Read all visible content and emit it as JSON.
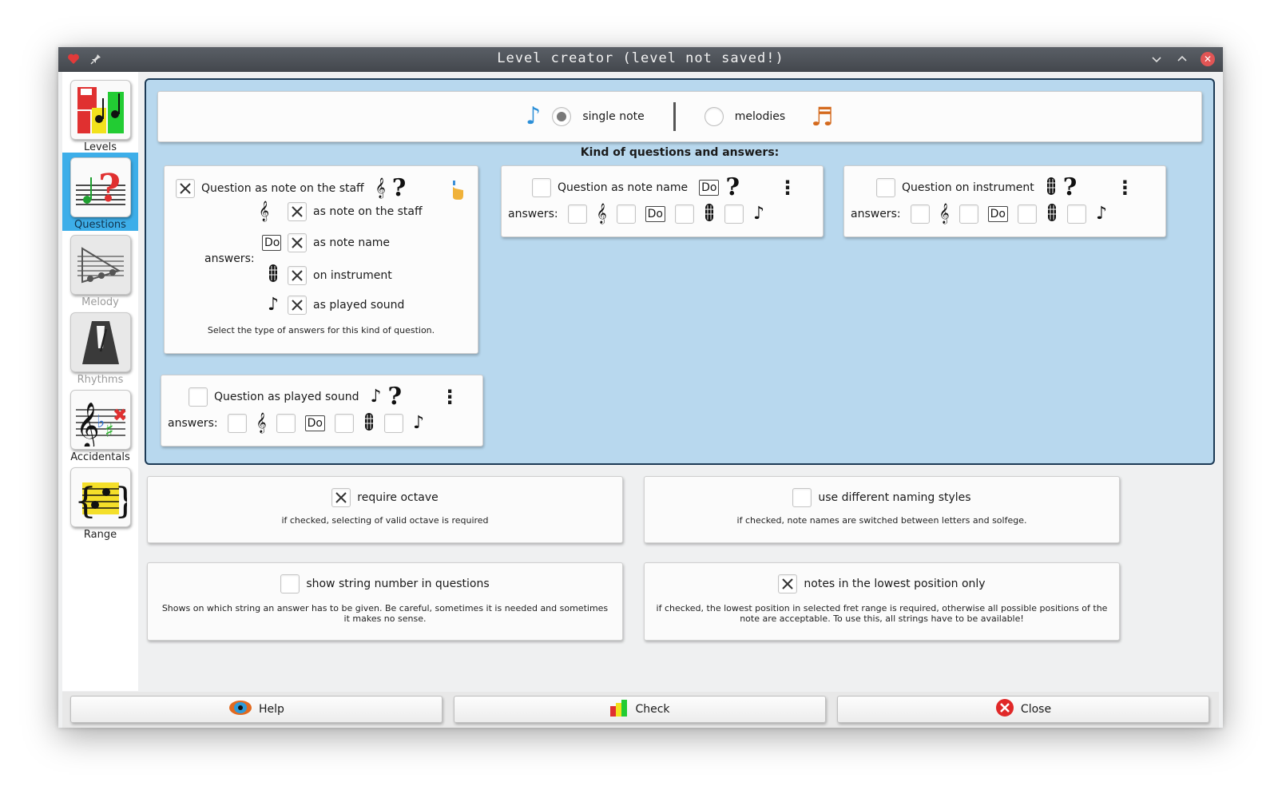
{
  "window": {
    "title": "Level creator (level not saved!)"
  },
  "sidebar": {
    "items": [
      {
        "label": "Levels",
        "active": false,
        "disabled": false
      },
      {
        "label": "Questions",
        "active": true,
        "disabled": false
      },
      {
        "label": "Melody",
        "active": false,
        "disabled": true
      },
      {
        "label": "Rhythms",
        "active": false,
        "disabled": true
      },
      {
        "label": "Accidentals",
        "active": false,
        "disabled": false
      },
      {
        "label": "Range",
        "active": false,
        "disabled": false
      }
    ]
  },
  "mode": {
    "single_note_label": "single note",
    "melodies_label": "melodies",
    "selected": "single note"
  },
  "kind_title": "Kind of questions and answers:",
  "question_staff": {
    "title": "Question as note on the staff",
    "checked": true,
    "answers_label": "answers:",
    "do_label": "Do",
    "answers": [
      {
        "label": "as note on the staff",
        "checked": true
      },
      {
        "label": "as note name",
        "checked": true
      },
      {
        "label": "on instrument",
        "checked": true
      },
      {
        "label": "as played sound",
        "checked": true
      }
    ],
    "hint": "Select the type of answers for this kind of question."
  },
  "question_name": {
    "title": "Question as note name",
    "checked": false,
    "answers_label": "answers:",
    "do_label": "Do"
  },
  "question_instrument": {
    "title": "Question on instrument",
    "checked": false,
    "answers_label": "answers:",
    "do_label": "Do"
  },
  "question_sound": {
    "title": "Question as played sound",
    "checked": false,
    "answers_label": "answers:",
    "do_label": "Do"
  },
  "options": {
    "require_octave": {
      "label": "require octave",
      "checked": true,
      "desc": "if checked, selecting of valid octave is required"
    },
    "naming_styles": {
      "label": "use different naming styles",
      "checked": false,
      "desc": "if checked, note names are switched between letters and solfege."
    },
    "string_number": {
      "label": "show string number in questions",
      "checked": false,
      "desc": "Shows on which string an answer has to be given. Be careful, sometimes it is needed and sometimes it makes no sense."
    },
    "lowest_position": {
      "label": "notes in the lowest position only",
      "checked": true,
      "desc": "if checked, the lowest position in selected fret range is required, otherwise all possible positions of the note are acceptable. To use this, all strings have to be available!"
    }
  },
  "buttons": {
    "help": "Help",
    "check": "Check",
    "close": "Close"
  },
  "colors": {
    "accent": "#3daee9",
    "panel": "#b8d8ee",
    "close_red": "#e02828"
  }
}
